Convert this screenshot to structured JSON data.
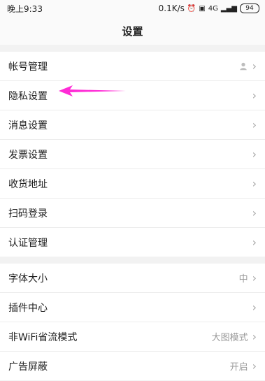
{
  "status_bar": {
    "time": "晚上9:33",
    "network_speed": "0.1K/s",
    "signal_label": "4G",
    "battery": "94"
  },
  "header": {
    "title": "设置"
  },
  "sections": [
    {
      "items": [
        {
          "label": "帐号管理",
          "value": "",
          "icon": "avatar-icon"
        },
        {
          "label": "隐私设置",
          "value": ""
        },
        {
          "label": "消息设置",
          "value": ""
        },
        {
          "label": "发票设置",
          "value": ""
        },
        {
          "label": "收货地址",
          "value": ""
        },
        {
          "label": "扫码登录",
          "value": ""
        },
        {
          "label": "认证管理",
          "value": ""
        }
      ]
    },
    {
      "items": [
        {
          "label": "字体大小",
          "value": "中"
        },
        {
          "label": "插件中心",
          "value": ""
        },
        {
          "label": "非WiFi省流模式",
          "value": "大图模式"
        },
        {
          "label": "广告屏蔽",
          "value": "开启"
        }
      ]
    }
  ],
  "colors": {
    "annotation_arrow": "#ff2bd6",
    "chevron": "#a7a7a7"
  }
}
